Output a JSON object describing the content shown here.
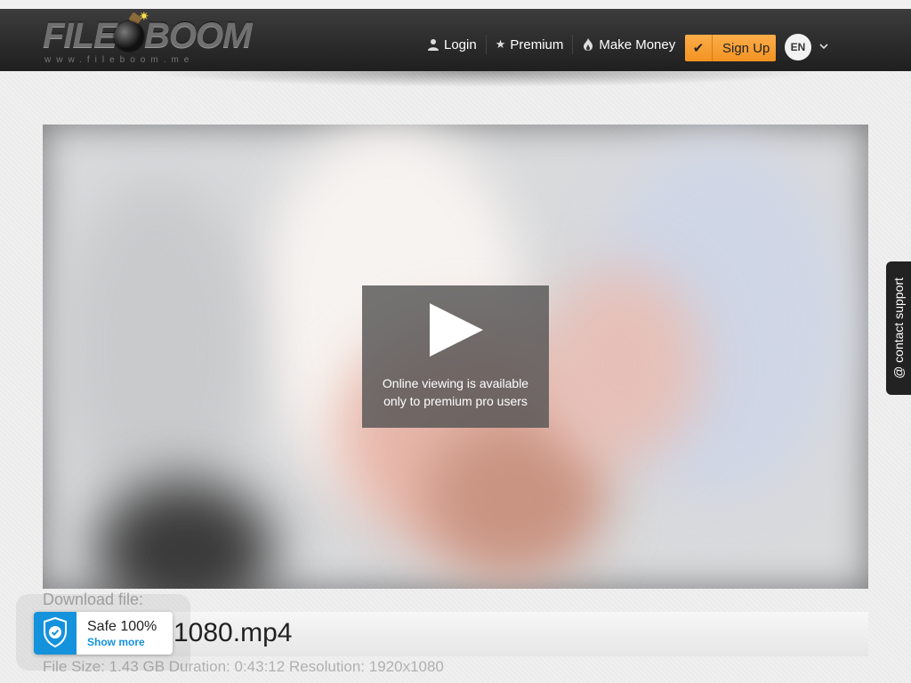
{
  "header": {
    "logo": {
      "part1": "FILE",
      "part2": "BOOM",
      "subtitle": "www.fileboom.me"
    },
    "nav": [
      {
        "label": "Login",
        "icon": "user-icon"
      },
      {
        "label": "Premium",
        "icon": "star-icon"
      },
      {
        "label": "Make Money",
        "icon": "flame-icon"
      }
    ],
    "signup": {
      "label": "Sign Up",
      "icon": "check-icon"
    },
    "language": {
      "code": "EN",
      "icon": "chevron-down-icon"
    }
  },
  "player": {
    "overlay_text_line1": "Online viewing is available",
    "overlay_text_line2": "only to premium pro users",
    "icon": "play-icon"
  },
  "file": {
    "download_label": "Download file:",
    "name_visible": "1080.mp4",
    "size_label": "File Size:",
    "size": "1.43 GB",
    "duration_label": "Duration:",
    "duration": "0:43:12",
    "resolution_label": "Resolution:",
    "resolution": "1920x1080"
  },
  "safe_badge": {
    "title": "Safe 100%",
    "link": "Show more",
    "icon": "shield-check-icon"
  },
  "support": {
    "label": "@ contact support"
  },
  "colors": {
    "accent": "#f39322",
    "badge_blue": "#1592dc",
    "header_dark": "#2a2a2a"
  }
}
